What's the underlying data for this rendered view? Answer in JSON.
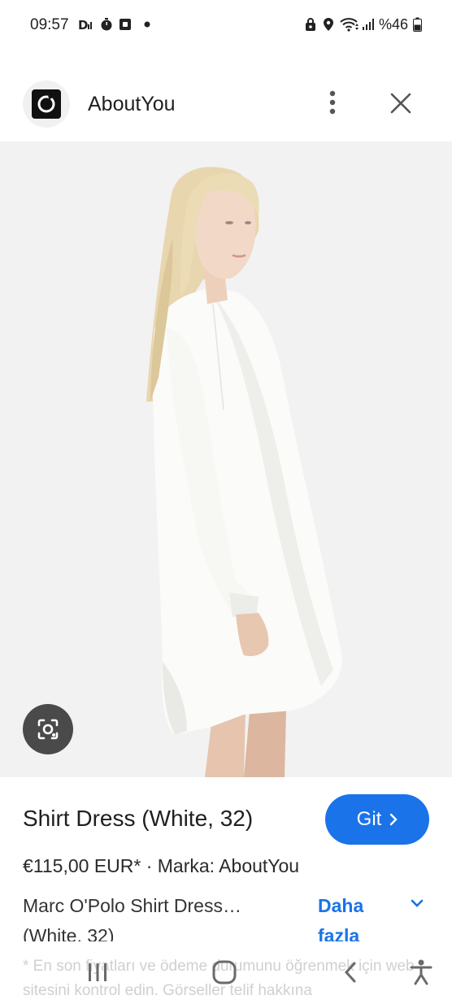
{
  "status_bar": {
    "time": "09:57",
    "battery_percent": "%46",
    "left_icons": [
      "signal-tool-icon",
      "timer-icon",
      "square-app-icon",
      "dot-icon"
    ],
    "right_icons": [
      "lock-icon",
      "location-icon",
      "wifi-icon",
      "cell-signal-icon",
      "battery-icon"
    ]
  },
  "header": {
    "site_name": "AboutYou",
    "icons": [
      "aboutyou-logo-icon",
      "more-vert-icon",
      "close-icon"
    ]
  },
  "product": {
    "title": "Shirt Dress (White, 32)",
    "go_button": "Git",
    "price_line": "€115,00 EUR* · Marka: AboutYou",
    "description": "Marc O'Polo Shirt Dress… (White, 32)",
    "more_label": "Daha fazla",
    "disclaimer": "* En son fiyatları ve ödeme durumunu öğrenmek için web sitesini kontrol edin. Görseller telif hakkına"
  },
  "colors": {
    "accent": "#1a73e8",
    "photo_bg": "#f2f2f2",
    "lens_button": "#4a4a4a"
  },
  "navbar": {
    "icons": [
      "recent-apps-icon",
      "home-icon",
      "back-icon",
      "accessibility-icon"
    ]
  }
}
